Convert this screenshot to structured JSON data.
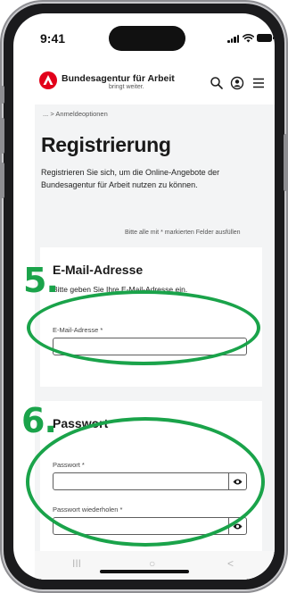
{
  "status_bar": {
    "time": "9:41"
  },
  "header": {
    "brand_name": "Bundesagentur für Arbeit",
    "tagline": "bringt weiter.",
    "icons": [
      "search-icon",
      "account-icon",
      "menu-icon"
    ],
    "brand_color": "#e2001a"
  },
  "breadcrumb": {
    "text": "... > Anmeldeoptionen"
  },
  "page": {
    "title": "Registrierung",
    "intro": "Registrieren Sie sich, um die Online-Angebote der Bundesagentur für Arbeit nutzen zu können.",
    "required_note": "Bitte alle mit * markierten Felder ausfüllen"
  },
  "email_section": {
    "title": "E-Mail-Adresse",
    "description": "Bitte geben Sie Ihre E-Mail-Adresse ein.",
    "field_label": "E-Mail-Adresse *",
    "field_value": ""
  },
  "password_section": {
    "title": "Passwort",
    "password_label": "Passwort *",
    "repeat_label": "Passwort wiederholen *",
    "password_value": "",
    "repeat_value": ""
  },
  "home_nav": {
    "recents": "III",
    "home": "○",
    "back": "<"
  },
  "annotations": {
    "step5": "5.",
    "step6": "6.",
    "color": "#1aa34a"
  }
}
